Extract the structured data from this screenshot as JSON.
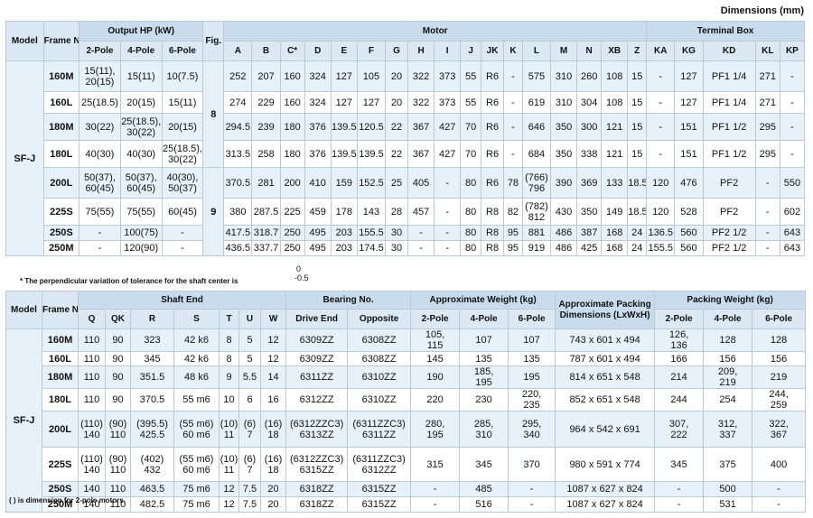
{
  "unit_label": "Dimensions (mm)",
  "table1": {
    "headers": {
      "model": "Model",
      "frame": "Frame No.",
      "output": "Output HP (kW)",
      "poles": [
        "2-Pole",
        "4-Pole",
        "6-Pole"
      ],
      "fig": "Fig.",
      "motor": "Motor",
      "motor_cols": [
        "A",
        "B",
        "C*",
        "D",
        "E",
        "F",
        "G",
        "H",
        "I",
        "J",
        "JK",
        "K",
        "L",
        "M",
        "N",
        "XB",
        "Z"
      ],
      "terminal": "Terminal Box",
      "terminal_cols": [
        "KA",
        "KG",
        "KD",
        "KL",
        "KP"
      ]
    },
    "model": "SF-J",
    "fig_values": [
      "8",
      "9"
    ],
    "rows": [
      [
        "160M",
        "15(11), 20(15)",
        "15(11)",
        "10(7.5)",
        "252",
        "207",
        "160",
        "324",
        "127",
        "105",
        "20",
        "322",
        "373",
        "55",
        "R6",
        "-",
        "575",
        "310",
        "260",
        "108",
        "15",
        "-",
        "127",
        "PF1 1/4",
        "271",
        "-"
      ],
      [
        "160L",
        "25(18.5)",
        "20(15)",
        "15(11)",
        "274",
        "229",
        "160",
        "324",
        "127",
        "127",
        "20",
        "322",
        "373",
        "55",
        "R6",
        "-",
        "619",
        "310",
        "304",
        "108",
        "15",
        "-",
        "127",
        "PF1 1/4",
        "271",
        "-"
      ],
      [
        "180M",
        "30(22)",
        "25(18.5), 30(22)",
        "20(15)",
        "294.5",
        "239",
        "180",
        "376",
        "139.5",
        "120.5",
        "22",
        "367",
        "427",
        "70",
        "R6",
        "-",
        "646",
        "350",
        "300",
        "121",
        "15",
        "-",
        "151",
        "PF1 1/2",
        "295",
        "-"
      ],
      [
        "180L",
        "40(30)",
        "40(30)",
        "25(18.5), 30(22)",
        "313.5",
        "258",
        "180",
        "376",
        "139.5",
        "139.5",
        "22",
        "367",
        "427",
        "70",
        "R6",
        "-",
        "684",
        "350",
        "338",
        "121",
        "15",
        "-",
        "151",
        "PF1 1/2",
        "295",
        "-"
      ],
      [
        "200L",
        "50(37), 60(45)",
        "50(37), 60(45)",
        "40(30), 50(37)",
        "370.5",
        "281",
        "200",
        "410",
        "159",
        "152.5",
        "25",
        "405",
        "-",
        "80",
        "R6",
        "78",
        "(766) 796",
        "390",
        "369",
        "133",
        "18.5",
        "120",
        "476",
        "PF2",
        "-",
        "550"
      ],
      [
        "225S",
        "75(55)",
        "75(55)",
        "60(45)",
        "380",
        "287.5",
        "225",
        "459",
        "178",
        "143",
        "28",
        "457",
        "-",
        "80",
        "R8",
        "82",
        "(782) 812",
        "430",
        "350",
        "149",
        "18.5",
        "120",
        "528",
        "PF2",
        "-",
        "602"
      ],
      [
        "250S",
        "-",
        "100(75)",
        "-",
        "417.5",
        "318.7",
        "250",
        "495",
        "203",
        "155.5",
        "30",
        "-",
        "-",
        "80",
        "R8",
        "95",
        "881",
        "486",
        "387",
        "168",
        "24",
        "136.5",
        "560",
        "PF2 1/2",
        "-",
        "643"
      ],
      [
        "250M",
        "-",
        "120(90)",
        "-",
        "436.5",
        "337.7",
        "250",
        "495",
        "203",
        "174.5",
        "30",
        "-",
        "-",
        "80",
        "R8",
        "95",
        "919",
        "486",
        "425",
        "168",
        "24",
        "155.5",
        "560",
        "PF2 1/2",
        "-",
        "643"
      ]
    ]
  },
  "tolerance_note": "* The perpendicular variation of tolerance for the shaft center is",
  "tolerance_upper": "0",
  "tolerance_lower": "-0.5",
  "table2": {
    "headers": {
      "model": "Model",
      "frame": "Frame No.",
      "shaft_end": "Shaft End",
      "shaft_cols": [
        "Q",
        "QK",
        "R",
        "S",
        "T",
        "U",
        "W"
      ],
      "bearing": "Bearing No.",
      "bearing_cols": [
        "Drive End",
        "Opposite"
      ],
      "weight": "Approximate Weight (kg)",
      "poles": [
        "2-Pole",
        "4-Pole",
        "6-Pole"
      ],
      "packing_dim": "Approximate Packing Dimensions (LxWxH)",
      "packing_weight": "Packing Weight (kg)",
      "packing_poles": [
        "2-Pole",
        "4-Pole",
        "6-Pole"
      ]
    },
    "model": "SF-J",
    "rows": [
      [
        "160M",
        "110",
        "90",
        "323",
        "42 k6",
        "8",
        "5",
        "12",
        "6309ZZ",
        "6308ZZ",
        "105, 115",
        "107",
        "107",
        "743 x 601 x 494",
        "126, 136",
        "128",
        "128"
      ],
      [
        "160L",
        "110",
        "90",
        "345",
        "42 k6",
        "8",
        "5",
        "12",
        "6309ZZ",
        "6308ZZ",
        "145",
        "135",
        "135",
        "787 x 601 x 494",
        "166",
        "156",
        "156"
      ],
      [
        "180M",
        "110",
        "90",
        "351.5",
        "48 k6",
        "9",
        "5.5",
        "14",
        "6311ZZ",
        "6310ZZ",
        "190",
        "185, 195",
        "195",
        "814 x 651 x 548",
        "214",
        "209, 219",
        "219"
      ],
      [
        "180L",
        "110",
        "90",
        "370.5",
        "55 m6",
        "10",
        "6",
        "16",
        "6312ZZ",
        "6310ZZ",
        "220",
        "230",
        "220, 235",
        "852 x 651 x 548",
        "244",
        "254",
        "244, 259"
      ],
      [
        "200L",
        "(110) 140",
        "(90) 110",
        "(395.5) 425.5",
        "(55 m6) 60 m6",
        "(10) 11",
        "(6) 7",
        "(16) 18",
        "(6312ZZC3) 6313ZZ",
        "(6311ZZC3) 6311ZZ",
        "280, 195",
        "285, 310",
        "295, 340",
        "964 x 542 x 691",
        "307, 222",
        "312, 337",
        "322, 367"
      ],
      [
        "225S",
        "(110) 140",
        "(90) 110",
        "(402) 432",
        "(55 m6) 60 m6",
        "(10) 11",
        "(6) 7",
        "(16) 18",
        "(6312ZZC3) 6315ZZ",
        "(6311ZZC3) 6312ZZ",
        "315",
        "345",
        "370",
        "980 x 591 x 774",
        "345",
        "375",
        "400"
      ],
      [
        "250S",
        "140",
        "110",
        "463.5",
        "75 m6",
        "12",
        "7.5",
        "20",
        "6318ZZ",
        "6315ZZ",
        "-",
        "485",
        "-",
        "1087 x 627 x 824",
        "-",
        "500",
        "-"
      ],
      [
        "250M",
        "140",
        "110",
        "482.5",
        "75 m6",
        "12",
        "7.5",
        "20",
        "6318ZZ",
        "6315ZZ",
        "-",
        "516",
        "-",
        "1087 x 627 x 824",
        "-",
        "531",
        "-"
      ]
    ]
  },
  "footnote": "( ) is dimension for 2-pole motors."
}
